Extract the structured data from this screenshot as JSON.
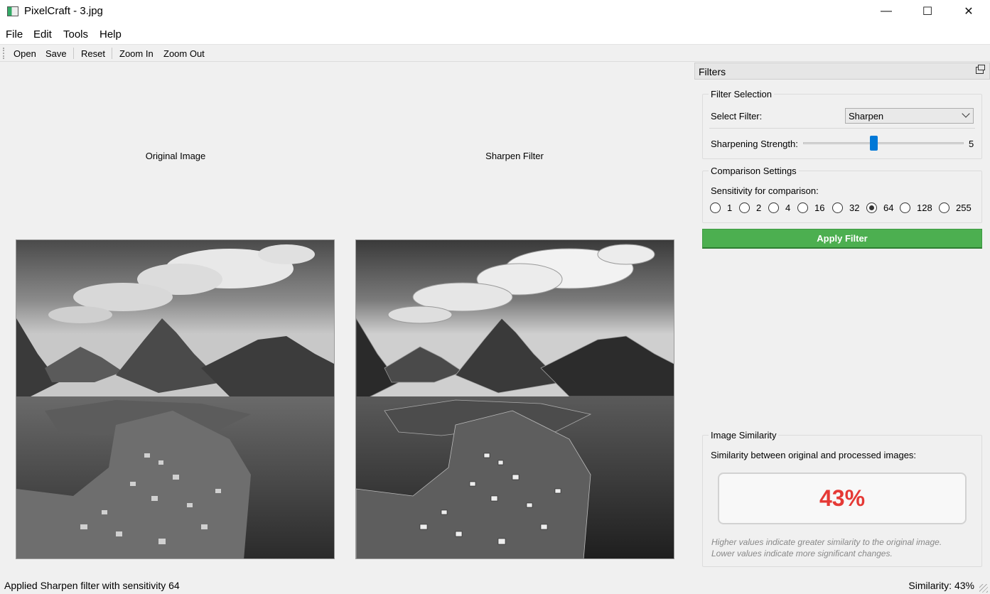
{
  "window": {
    "title": "PixelCraft - 3.jpg",
    "minimize": "—",
    "maximize": "☐",
    "close": "✕"
  },
  "menu": [
    "File",
    "Edit",
    "Tools",
    "Help"
  ],
  "toolbar": [
    "Open",
    "Save",
    "Reset",
    "Zoom In",
    "Zoom Out"
  ],
  "images": {
    "original_label": "Original Image",
    "processed_label": "Sharpen Filter"
  },
  "dock": {
    "title": "Filters",
    "filter_selection": {
      "title": "Filter Selection",
      "select_label": "Select Filter:",
      "selected_filter": "Sharpen",
      "strength_label": "Sharpening Strength:",
      "strength_value": "5",
      "strength_fraction": 0.44
    },
    "comparison": {
      "title": "Comparison Settings",
      "sensitivity_label": "Sensitivity for comparison:",
      "options": [
        "1",
        "2",
        "4",
        "16",
        "32",
        "64",
        "128",
        "255"
      ],
      "selected": "64"
    },
    "apply_label": "Apply Filter",
    "similarity": {
      "title": "Image Similarity",
      "caption": "Similarity between original and processed images:",
      "value": "43%",
      "value_color": "#e53935",
      "note1": "Higher values indicate greater similarity to the original image.",
      "note2": "Lower values indicate more significant changes."
    }
  },
  "status": {
    "message": "Applied Sharpen filter with sensitivity 64",
    "similarity": "Similarity: 43%"
  }
}
